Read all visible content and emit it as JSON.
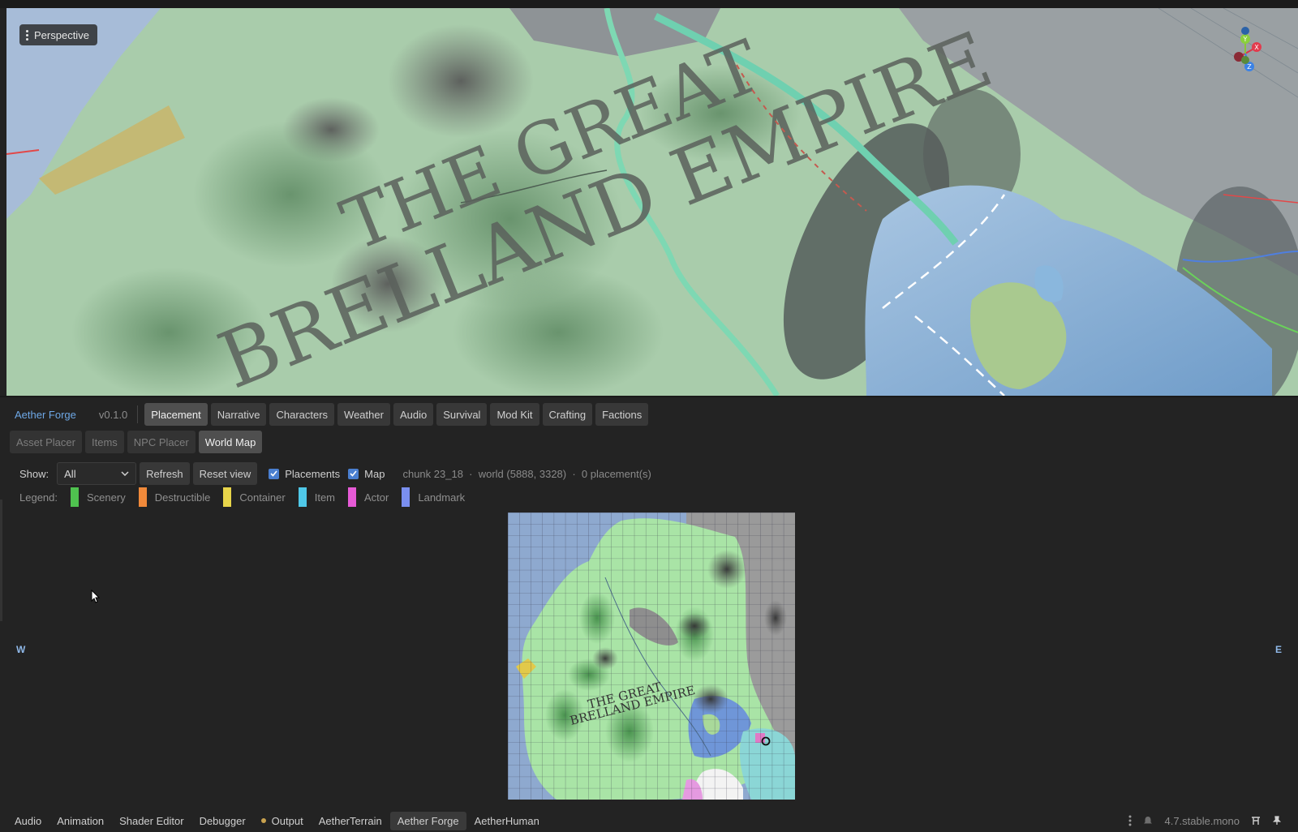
{
  "viewport": {
    "mode_label": "Perspective",
    "map_title_line1": "THE GREAT",
    "map_title_line2": "BRELLAND EMPIRE",
    "gizmo_axes": [
      "X",
      "Y",
      "Z"
    ]
  },
  "plugin": {
    "name": "Aether Forge",
    "version": "v0.1.0",
    "tabs": [
      "Placement",
      "Narrative",
      "Characters",
      "Weather",
      "Audio",
      "Survival",
      "Mod Kit",
      "Crafting",
      "Factions"
    ],
    "active_tab": "Placement"
  },
  "subtabs": {
    "items": [
      "Asset Placer",
      "Items",
      "NPC Placer",
      "World Map"
    ],
    "active": "World Map"
  },
  "toolbar": {
    "show_label": "Show:",
    "show_value": "All",
    "refresh_label": "Refresh",
    "reset_view_label": "Reset view",
    "placements_label": "Placements",
    "placements_checked": true,
    "map_label": "Map",
    "map_checked": true,
    "chunk_info": "chunk 23_18",
    "world_info": "world (5888, 3328)",
    "placements_info": "0 placement(s)"
  },
  "legend": {
    "title": "Legend:",
    "items": [
      {
        "label": "Scenery",
        "color": "#4fc24f"
      },
      {
        "label": "Destructible",
        "color": "#f0893a"
      },
      {
        "label": "Container",
        "color": "#e8d54a"
      },
      {
        "label": "Item",
        "color": "#4fc8e8"
      },
      {
        "label": "Actor",
        "color": "#e65ad6"
      },
      {
        "label": "Landmark",
        "color": "#7a8ff0"
      }
    ]
  },
  "compass": {
    "west": "W",
    "east": "E"
  },
  "minimap": {
    "title_line1": "THE GREAT",
    "title_line2": "BRELLAND EMPIRE"
  },
  "bottom_tabs": {
    "items": [
      "Audio",
      "Animation",
      "Shader Editor",
      "Debugger",
      "Output",
      "AetherTerrain",
      "Aether Forge",
      "AetherHuman"
    ],
    "active": "Aether Forge"
  },
  "status": {
    "version": "4.7.stable.mono"
  },
  "icons": [
    "kebab-menu-icon",
    "chevron-down-icon",
    "check-icon",
    "mouse-cursor-icon",
    "pin-icon",
    "layout-icon",
    "bell-icon"
  ]
}
